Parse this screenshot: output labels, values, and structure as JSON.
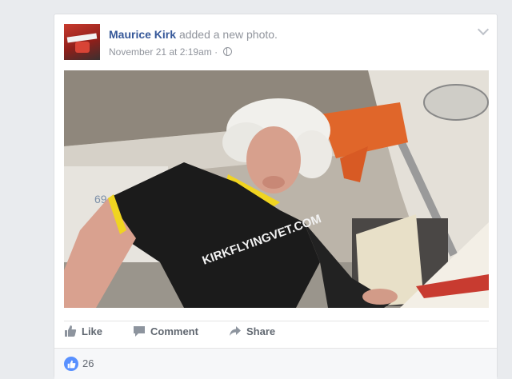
{
  "post": {
    "author": "Maurice Kirk",
    "action": "added a new photo.",
    "timestamp": "November 21 at 2:19am",
    "separator": "·",
    "privacy_icon": "globe-icon",
    "menu_icon": "chevron-down-icon"
  },
  "photo": {
    "shirt_text": "KIRKFLYINGVET.COM",
    "plane_number": "69"
  },
  "actions": {
    "like": "Like",
    "comment": "Comment",
    "share": "Share"
  },
  "reactions": {
    "count": "26",
    "icon": "like-reaction-icon"
  },
  "colors": {
    "author": "#365899",
    "meta": "#90949c",
    "action": "#606770",
    "reaction_blue": "#5890ff",
    "background": "#e9ebee"
  }
}
